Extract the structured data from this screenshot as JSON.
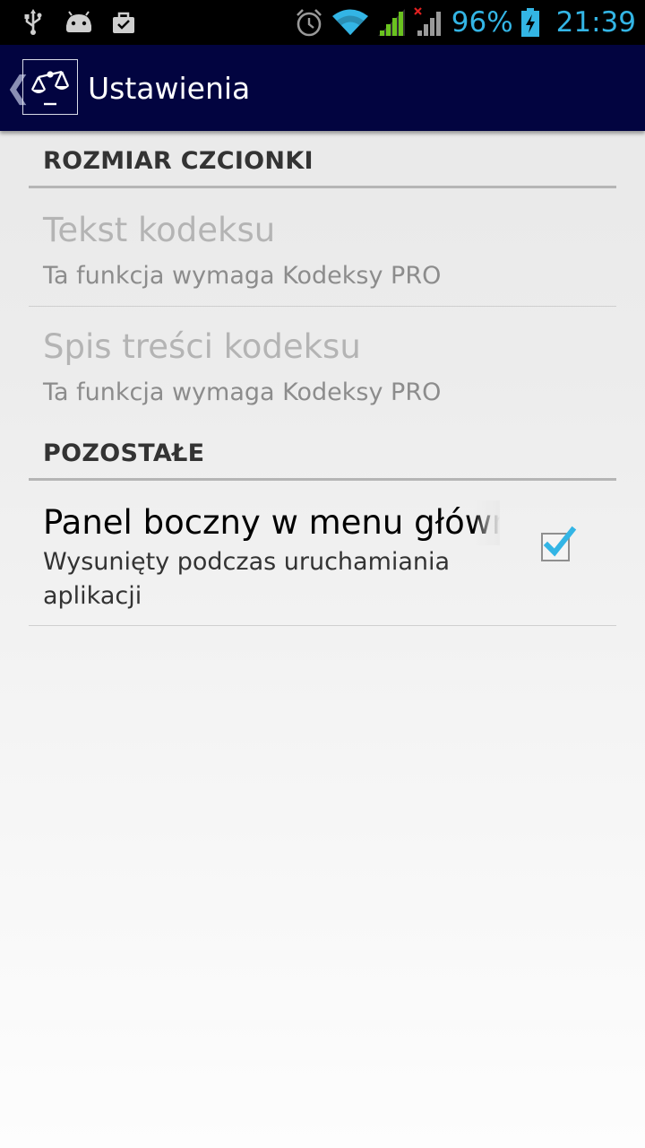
{
  "status_bar": {
    "battery_percent": "96%",
    "time": "21:39",
    "icons": [
      "usb-icon",
      "android-debug-icon",
      "briefcase-icon",
      "alarm-icon",
      "wifi-icon",
      "signal-icon",
      "signal-no-data-icon",
      "battery-charging-icon"
    ],
    "accent_color": "#33b5e5"
  },
  "action_bar": {
    "title": "Ustawienia",
    "icon": "scales-of-justice-icon",
    "background_color": "#020440"
  },
  "sections": [
    {
      "title": "ROZMIAR CZCIONKI",
      "items": [
        {
          "title": "Tekst kodeksu",
          "summary": "Ta funkcja wymaga Kodeksy PRO",
          "enabled": false
        },
        {
          "title": "Spis treści kodeksu",
          "summary": "Ta funkcja wymaga Kodeksy PRO",
          "enabled": false
        }
      ]
    },
    {
      "title": "POZOSTAŁE",
      "items": [
        {
          "title": "Panel boczny w menu główn",
          "summary": "Wysunięty podczas uruchamiania aplikacji",
          "enabled": true,
          "checked": true
        }
      ]
    }
  ]
}
